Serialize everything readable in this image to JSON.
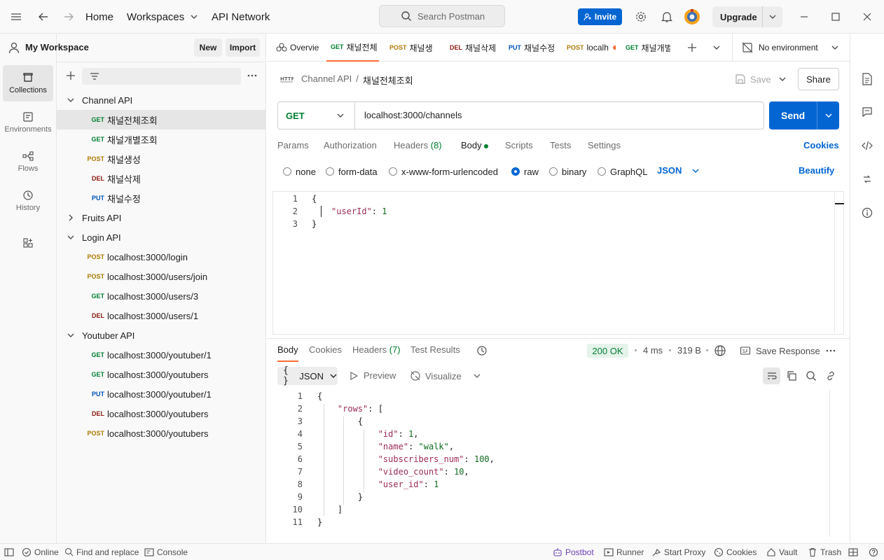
{
  "titlebar": {
    "home": "Home",
    "workspaces": "Workspaces",
    "api_network": "API Network",
    "search_placeholder": "Search Postman",
    "invite": "Invite",
    "upgrade": "Upgrade"
  },
  "rail": {
    "collections": "Collections",
    "environments": "Environments",
    "flows": "Flows",
    "history": "History"
  },
  "sidebar": {
    "workspace_name": "My Workspace",
    "new_label": "New",
    "import_label": "Import",
    "tree": [
      {
        "type": "folder",
        "label": "Channel API",
        "expanded": true
      },
      {
        "type": "request",
        "method": "GET",
        "label": "채널전체조회",
        "active": true
      },
      {
        "type": "request",
        "method": "GET",
        "label": "채널개별조회"
      },
      {
        "type": "request",
        "method": "POST",
        "label": "채널생성"
      },
      {
        "type": "request",
        "method": "DEL",
        "label": "채널삭제"
      },
      {
        "type": "request",
        "method": "PUT",
        "label": "채널수정"
      },
      {
        "type": "folder",
        "label": "Fruits API",
        "expanded": false
      },
      {
        "type": "folder",
        "label": "Login API",
        "expanded": true
      },
      {
        "type": "request",
        "method": "POST",
        "label": "localhost:3000/login"
      },
      {
        "type": "request",
        "method": "POST",
        "label": "localhost:3000/users/join"
      },
      {
        "type": "request",
        "method": "GET",
        "label": "localhost:3000/users/3"
      },
      {
        "type": "request",
        "method": "DEL",
        "label": "localhost:3000/users/1"
      },
      {
        "type": "folder",
        "label": "Youtuber API",
        "expanded": true
      },
      {
        "type": "request",
        "method": "GET",
        "label": "localhost:3000/youtuber/1"
      },
      {
        "type": "request",
        "method": "GET",
        "label": "localhost:3000/youtubers"
      },
      {
        "type": "request",
        "method": "PUT",
        "label": "localhost:3000/youtuber/1"
      },
      {
        "type": "request",
        "method": "DEL",
        "label": "localhost:3000/youtubers"
      },
      {
        "type": "request",
        "method": "POST",
        "label": "localhost:3000/youtubers"
      }
    ]
  },
  "tabs": [
    {
      "method": "",
      "label": "Overvie"
    },
    {
      "method": "GET",
      "label": "채널전체",
      "active": true
    },
    {
      "method": "POST",
      "label": "채널생"
    },
    {
      "method": "DEL",
      "label": "채널삭제"
    },
    {
      "method": "PUT",
      "label": "채널수정"
    },
    {
      "method": "POST",
      "label": "localh",
      "unsaved": true
    },
    {
      "method": "GET",
      "label": "채널개별"
    }
  ],
  "environment": "No environment",
  "request": {
    "breadcrumb_parent": "Channel API",
    "breadcrumb_sep": "/",
    "name": "채널전체조회",
    "save": "Save",
    "share": "Share",
    "method": "GET",
    "url": "localhost:3000/channels",
    "send": "Send",
    "subtabs": [
      "Params",
      "Authorization",
      "Headers (8)",
      "Body",
      "Scripts",
      "Tests",
      "Settings"
    ],
    "cookies": "Cookies",
    "body_modes": [
      "none",
      "form-data",
      "x-www-form-urlencoded",
      "raw",
      "binary",
      "GraphQL"
    ],
    "body_format": "JSON",
    "beautify": "Beautify",
    "line_numbers": [
      "1",
      "2",
      "3"
    ],
    "body_lines": [
      "{",
      "\"userId\": 1",
      "}"
    ]
  },
  "response": {
    "tabs": [
      "Body",
      "Cookies",
      "Headers (7)",
      "Test Results"
    ],
    "status": "200 OK",
    "time": "4 ms",
    "size": "319 B",
    "save_response": "Save Response",
    "format": "JSON",
    "preview": "Preview",
    "visualize": "Visualize",
    "line_numbers": [
      "1",
      "2",
      "3",
      "4",
      "5",
      "6",
      "7",
      "8",
      "9",
      "10",
      "11"
    ],
    "lines": [
      "{",
      "    \"rows\": [",
      "        {",
      "            \"id\": 1,",
      "            \"name\": \"walk\",",
      "            \"subscribers_num\": 100,",
      "            \"video_count\": 10,",
      "            \"user_id\": 1",
      "        }",
      "    ]",
      "}"
    ]
  },
  "statusbar": {
    "online": "Online",
    "find_replace": "Find and replace",
    "console": "Console",
    "postbot": "Postbot",
    "runner": "Runner",
    "start_proxy": "Start Proxy",
    "cookies": "Cookies",
    "vault": "Vault",
    "trash": "Trash"
  },
  "colors": {
    "accent": "#0265d2",
    "brand_orange": "#ff6c37",
    "get": "#007f31",
    "post": "#ad7a03",
    "del": "#8e1a10",
    "put": "#0053b8",
    "status_ok": "#007f31"
  }
}
